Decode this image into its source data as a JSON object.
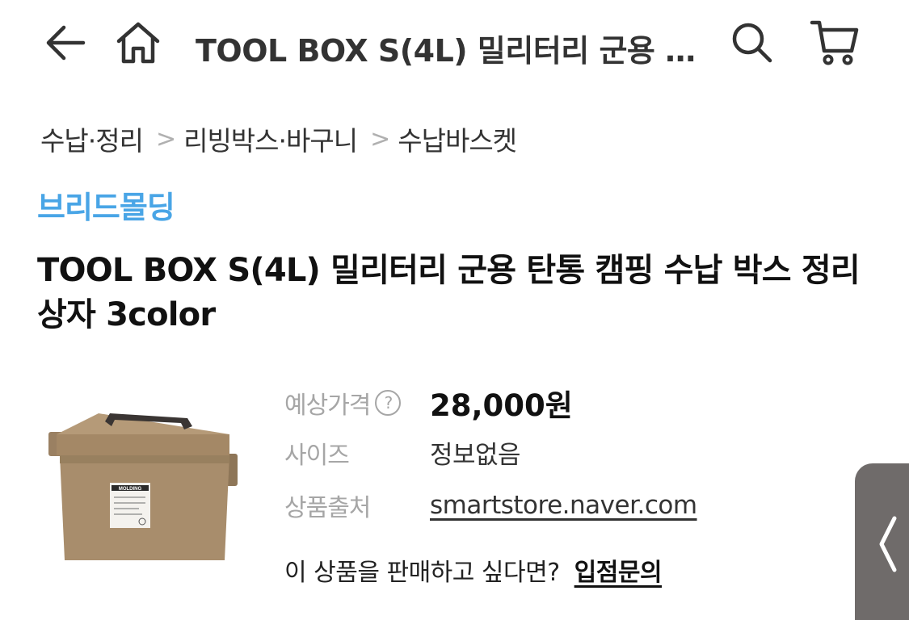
{
  "header": {
    "title": "TOOL BOX S(4L) 밀리터리 군용 탄통 캠핑 수납 박스 정리 상자 3color",
    "icons": [
      "back-arrow-icon",
      "home-icon",
      "search-icon",
      "cart-icon"
    ]
  },
  "breadcrumb": [
    "수납·정리",
    "리빙박스·바구니",
    "수납바스켓"
  ],
  "product": {
    "brand": "브리드몰딩",
    "title": "TOOL BOX S(4L) 밀리터리 군용 탄통 캠핑 수납 박스 정리 상자 3color",
    "image_label": "MOLDING"
  },
  "info": {
    "price_label": "예상가격",
    "price_value": "28,000원",
    "size_label": "사이즈",
    "size_value": "정보없음",
    "source_label": "상품출처",
    "source_value": "smartstore.naver.com"
  },
  "seller": {
    "question": "이 상품을 판매하고 싶다면?",
    "link": "입점문의"
  },
  "colors": {
    "brand_blue": "#49a5e6",
    "box_tan": "#a88d6c",
    "side_tab": "#6f6b6a"
  }
}
